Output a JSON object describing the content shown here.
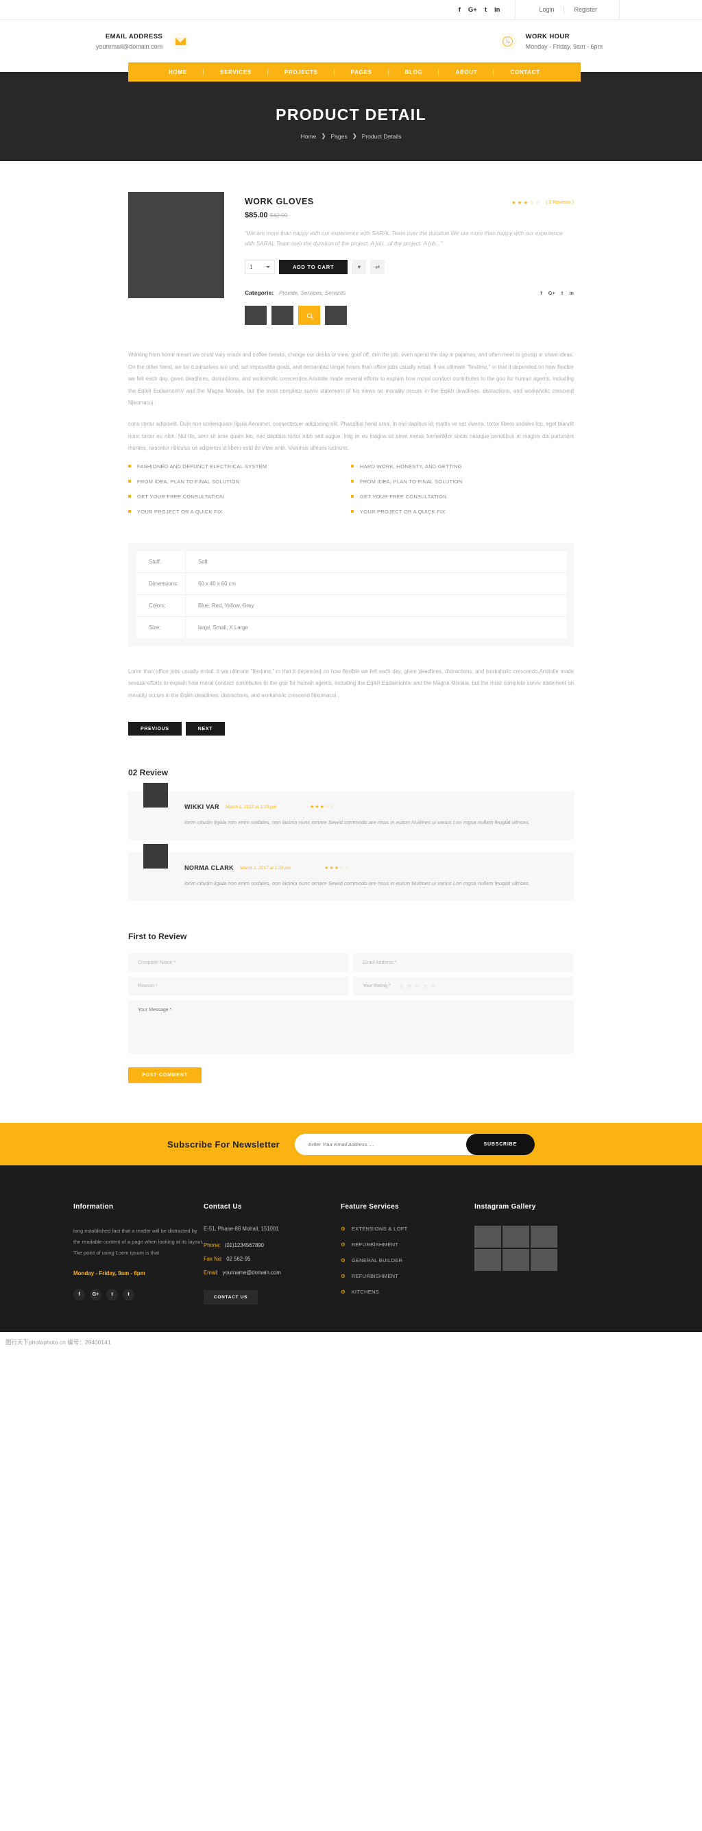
{
  "topbar": {
    "social": [
      "f",
      "G+",
      "t",
      "in"
    ],
    "login": "Login",
    "register": "Register"
  },
  "infobar": {
    "email_title": "EMAIL ADDRESS",
    "email_value": "youremail@domain.com",
    "hour_title": "WORK HOUR",
    "hour_value": "Monday - Friday, 9am - 6pm"
  },
  "nav": {
    "items": [
      "HOME",
      "SERVICES",
      "PROJECTS",
      "PAGES",
      "BLOG",
      "ABOUT",
      "CONTACT"
    ]
  },
  "hero": {
    "title": "PRODUCT DETAIL",
    "crumb_home": "Home",
    "crumb_pages": "Pages",
    "crumb_current": "Product Details",
    "sep": "❯"
  },
  "product": {
    "title": "WORK GLOVES",
    "price": "$85.00",
    "old_price": "$42.00",
    "rating": 3,
    "reviews_label": "( 2 Reviews )",
    "description": "\"We are more than happy with our experience with SARAL Team over the duration We are more than happy with our experience with SARAL Team over the duration of the project. A job...of the project. A job...\"",
    "qty_value": "1",
    "add_to_cart": "ADD TO CART",
    "wishlist_icon": "♥",
    "compare_icon": "⇄",
    "category_label": "Categorie:",
    "category_values": "Provide, Services, Services",
    "share": [
      "f",
      "G+",
      "t",
      "in"
    ]
  },
  "body": {
    "p1": "Working from home meant we could vary snack and coffee breaks, change our desks or view, goof off, drin the job, even spend the day in pajamas, and often meet to gossip or share ideas. On the other hand, we bo d ourselves aro und, set impossible goals, and demanded longer hours than office jobs usually entail. It wa ultimate \"flextime,\" in that it depended on how flexible we felt each day, given deadlines, distractions, and workaholic crescendos.Aristotle made several efforts to explain how moral conduct contributes to the goo for human agents, including the Eqikh EudaimonhV and the Magna Moralia, but the most complete surviv statement of his views on morality occurs in the Eqikh deadlines, distractions, and workaholic crescend Nikomacoi .",
    "p2": "cons ctetur adipiselit. Duis non sceleriquiam ligula.Aenamet, consectetuer adipiscing elit. Phasellus hend urna. In nisi dapibus id, mattis ve eet viverra, tortor libero sodales leo, eget blandit nunc tortor eu nibh. Nul llis, sem sit ame quam leo, nec dapibus tortor nibh sed augue. Intg er eu magna sit amet metus fermenMor sociis natoque penatibus et magnis dis parturient montes, nascetur ridiculus ue adipieros ut libero estd do vitae ante. Vivamus ultrices lucinunc.",
    "closing": "Lorim than office jobs usually entail. It wa ultimate \"flextime,\" in that it depended on how flexible we felt each day, given deadlines, distractions, and workaholic crescendo,Aristotle made several efforts to explain how moral conduct contributes to the goo for human agents, including the Eqikh Eudaimonhv and the Magna Moralia, but the most complete surviv statement on morality occurs in the Eqikh deadlines, distractions, and workaholic crescend Nikomacoi ."
  },
  "features": {
    "left": [
      "FASHIONED AND DEFUNCT ELECTRICAL SYSTEM",
      "FROM IDEA, PLAN TO FINAL SOLUTION",
      "GET YOUR FREE CONSULTATION",
      "YOUR PROJECT OR A QUICK FIX"
    ],
    "right": [
      "HARD WORK, HONESTY, AND GETTING",
      "FROM IDEA, PLAN TO FINAL SOLUTION",
      "GET YOUR FREE CONSULTATION",
      "YOUR PROJECT OR A QUICK FIX"
    ]
  },
  "spec_table": {
    "rows": [
      {
        "key": "Stuff:",
        "value": "Soft"
      },
      {
        "key": "Dimensions:",
        "value": "60 x 40 x 60 cm"
      },
      {
        "key": "Colors:",
        "value": "Blue, Red, Yellow, Grey"
      },
      {
        "key": "Size:",
        "value": "large, Small, X Large"
      }
    ]
  },
  "pagination": {
    "previous": "PREVIOUS",
    "next": "NEXT"
  },
  "reviews": {
    "heading": "02 Review",
    "items": [
      {
        "name": "WIKKI VAR",
        "date": "March 1, 2017 at 1:23 pm",
        "rating": 3,
        "text": "lorim citudin ligula non enim sodales, non lacinia nunc ornare Sewid commodo are risus in euism Nuilmes ui varius Lori mgsa nullam feugiat ultrices."
      },
      {
        "name": "NORMA CLARK",
        "date": "March 1, 2017 at 1:23 pm",
        "rating": 3,
        "text": "lorim citudin ligula non enim sodales, non lacinia nunc ornare Sewid commodo are risus in euism Nuilmes ui varius Lori mgsa nullam feugiat ultrices."
      }
    ]
  },
  "review_form": {
    "heading": "First to Review",
    "name_placeholder": "Complete Name *",
    "email_placeholder": "Email Address *",
    "reason_placeholder": "Reason *",
    "rating_label": "Your Rating *",
    "message_placeholder": "Your Message *",
    "submit": "POST COMMENT"
  },
  "newsletter": {
    "title": "Subscribe For Newsletter",
    "placeholder": "Enter Your Email Address.....",
    "button": "SUBSCRIBE"
  },
  "footer": {
    "information": {
      "title": "Information",
      "text": "long established fact that a reader will be distracted by the readable content of a page when looking at its layout. The point of using Loem Ipsum is that",
      "hours": "Monday - Friday, 9am - 6pm",
      "social": [
        "f",
        "G+",
        "t",
        "t"
      ]
    },
    "contact": {
      "title": "Contact Us",
      "address": "E-51, Phase-88 Mohali, 151001",
      "phone_label": "Phone:",
      "phone_value": "(01)1234567890",
      "fax_label": "Fax No:",
      "fax_value": "02 562-95",
      "email_label": "Email:",
      "email_value": "yourname@domain.com",
      "button": "CONTACT US"
    },
    "services": {
      "title": "Feature Services",
      "items": [
        "EXTENSIONS & LOFT",
        "REFURBISHMENT",
        "GENERAL BUILDER",
        "REFURBISHMENT",
        "KITCHENS"
      ]
    },
    "gallery": {
      "title": "Instagram Gallery",
      "count": 6
    }
  },
  "watermark": "图行天下photophoto.cn 编号：29400141",
  "colors": {
    "accent": "#fbb313",
    "dark": "#1c1c1c",
    "hero": "#282828"
  }
}
